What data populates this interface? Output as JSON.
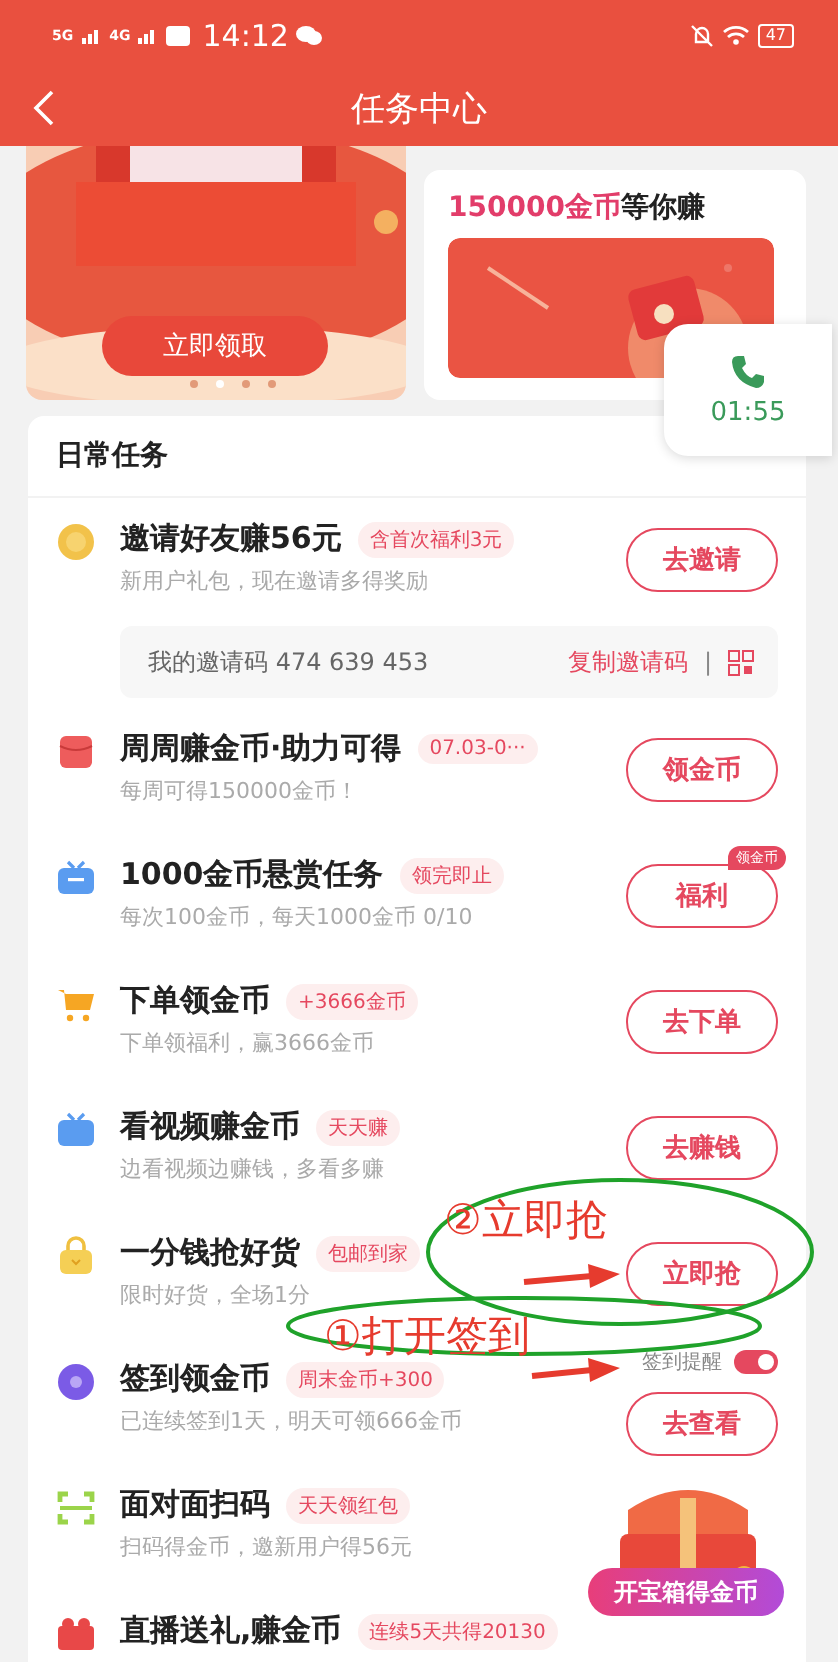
{
  "status_bar": {
    "network_1": "5G",
    "network_2": "4G",
    "time": "14:12",
    "battery": "47"
  },
  "header": {
    "title": "任务中心"
  },
  "banners": [
    {
      "kind": "picture",
      "button": "立即领取",
      "page_dots": [
        {
          "selected": false
        },
        {
          "selected": true
        },
        {
          "selected": false
        },
        {
          "selected": false
        }
      ]
    },
    {
      "kind": "picture",
      "title_highlight": "150000金币",
      "title_rest": "等你赚"
    }
  ],
  "call_widget": {
    "duration": "01:55"
  },
  "tasks": {
    "title": "日常任务",
    "items": [
      {
        "title": "邀请好友赚56元",
        "tag": "含首次福利3元",
        "subtitle": "新用户礼包，现在邀请多得奖励",
        "button": "去邀请",
        "invite": {
          "label": "我的邀请码 474 639 453",
          "copy": "复制邀请码",
          "separator": "|"
        }
      },
      {
        "title": "周周赚金币·助力可得",
        "tag": "07.03-0···",
        "subtitle": "每周可得150000金币！",
        "button": "领金币"
      },
      {
        "title": "1000金币悬赏任务",
        "tag": "领完即止",
        "subtitle": "每次100金币，每天1000金币 0/10",
        "button": "福利",
        "button_badge": "领金币"
      },
      {
        "title": "下单领金币",
        "tag": "+3666金币",
        "subtitle": "下单领福利，赢3666金币",
        "button": "去下单"
      },
      {
        "title": "看视频赚金币",
        "tag": "天天赚",
        "subtitle": "边看视频边赚钱，多看多赚",
        "button": "去赚钱"
      },
      {
        "title": "一分钱抢好货",
        "tag": "包邮到家",
        "subtitle": "限时好货，全场1分",
        "button": "立即抢"
      },
      {
        "title": "签到领金币",
        "tag": "周末金币+300",
        "subtitle": "已连续签到1天，明天可领666金币",
        "button": "去查看",
        "reminder": {
          "label": "签到提醒",
          "on": true
        }
      },
      {
        "title": "面对面扫码",
        "tag": "天天领红包",
        "subtitle": "扫码得金币，邀新用户得56元"
      },
      {
        "title": "直播送礼,赚金币",
        "tag": "连续5天共得20130"
      }
    ]
  },
  "treasure": {
    "label": "开宝箱得金币"
  },
  "annotations": [
    {
      "text": "②立即抢"
    },
    {
      "text": "①打开签到"
    }
  ]
}
